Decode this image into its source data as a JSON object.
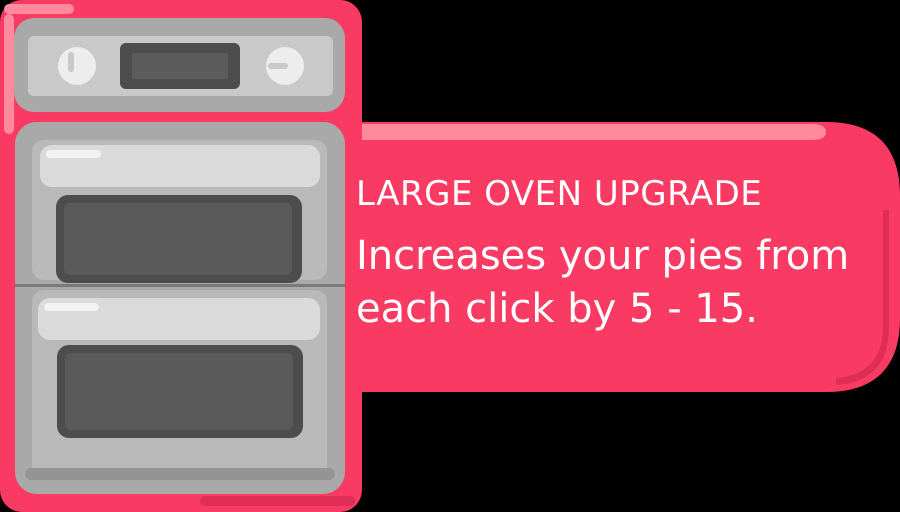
{
  "upgrade": {
    "title": "LARGE OVEN UPGRADE",
    "description_line1": "Increases your pies from",
    "description_line2": "each click by 5 - 15."
  },
  "colors": {
    "panel": "#f93b64",
    "panel_highlight": "#ff8a9d",
    "panel_shadow": "#e02d55",
    "oven_body": "#a9a9a9",
    "oven_light": "#c9c9c9",
    "oven_dark": "#4d4d4d",
    "text": "#ffffff"
  },
  "icons": {
    "oven": "double-oven-icon"
  }
}
